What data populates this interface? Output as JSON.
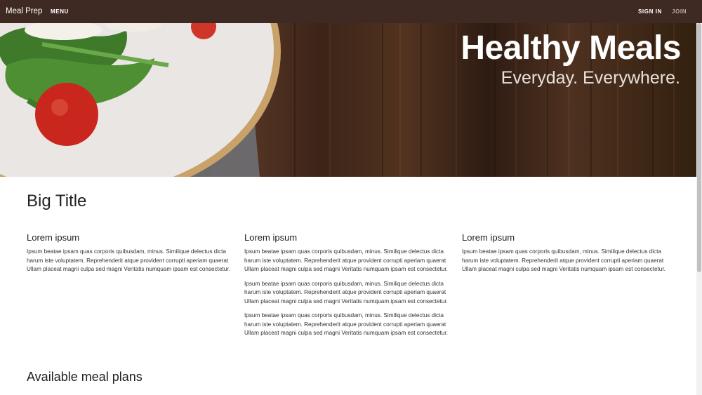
{
  "topbar": {
    "brand": "Meal Prep",
    "menu_label": "MENU",
    "signin_label": "SIGN IN",
    "join_label": "JOIN"
  },
  "hero": {
    "title": "Healthy Meals",
    "subtitle": "Everyday. Everywhere."
  },
  "content": {
    "big_title": "Big Title",
    "columns": [
      {
        "heading": "Lorem ipsum",
        "paragraphs": [
          "Ipsum beatae ipsam quas corporis quibusdam, minus. Similique delectus dicta harum iste voluptatem. Reprehenderit atque provident corrupti aperiam quaerat Ullam placeat magni culpa sed magni Veritatis numquam ipsam est consectetur."
        ]
      },
      {
        "heading": "Lorem ipsum",
        "paragraphs": [
          "Ipsum beatae ipsam quas corporis quibusdam, minus. Similique delectus dicta harum iste voluptatem. Reprehenderit atque provident corrupti aperiam quaerat Ullam placeat magni culpa sed magni Veritatis numquam ipsam est consectetur.",
          "Ipsum beatae ipsam quas corporis quibusdam, minus. Similique delectus dicta harum iste voluptatem. Reprehenderit atque provident corrupti aperiam quaerat Ullam placeat magni culpa sed magni Veritatis numquam ipsam est consectetur.",
          "Ipsum beatae ipsam quas corporis quibusdam, minus. Similique delectus dicta harum iste voluptatem. Reprehenderit atque provident corrupti aperiam quaerat Ullam placeat magni culpa sed magni Veritatis numquam ipsam est consectetur."
        ]
      },
      {
        "heading": "Lorem ipsum",
        "paragraphs": [
          "Ipsum beatae ipsam quas corporis quibusdam, minus. Similique delectus dicta harum iste voluptatem. Reprehenderit atque provident corrupti aperiam quaerat Ullam placeat magni culpa sed magni Veritatis numquam ipsam est consectetur."
        ]
      }
    ],
    "plans_title": "Available meal plans"
  },
  "colors": {
    "topbar_bg": "#3e2a23",
    "hero_text": "#ffffff",
    "body_text": "#222222"
  }
}
